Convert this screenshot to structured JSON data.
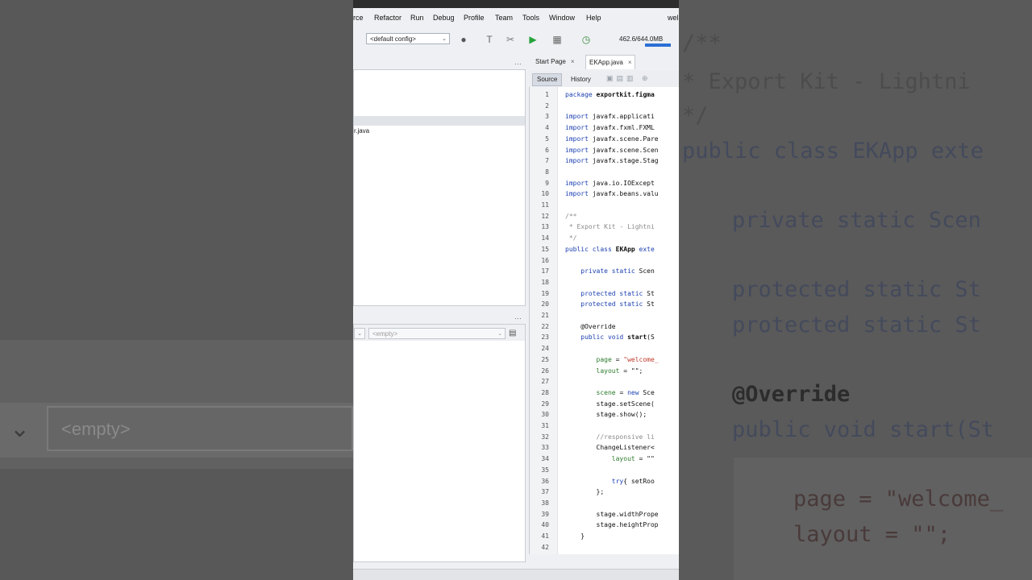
{
  "menu": [
    "rce",
    "Refactor",
    "Run",
    "Debug",
    "Profile",
    "Team",
    "Tools",
    "Window",
    "Help"
  ],
  "menu_right": "wel",
  "toolbar": {
    "config": "<default config>",
    "memory": "462.6/644.0MB"
  },
  "left_panel": {
    "file": "r.java"
  },
  "navigator": {
    "selector": "<empty>"
  },
  "tabs": [
    {
      "label": "Start Page"
    },
    {
      "label": "EKApp.java"
    }
  ],
  "editor_views": {
    "source": "Source",
    "history": "History"
  },
  "code_lines": [
    {
      "n": "1",
      "segs": [
        [
          "k",
          "package "
        ],
        [
          "bd",
          "exportkit.figma"
        ]
      ]
    },
    {
      "n": "2",
      "segs": []
    },
    {
      "n": "3",
      "segs": [
        [
          "k",
          "import "
        ],
        [
          "",
          "javafx.applicati"
        ]
      ]
    },
    {
      "n": "4",
      "segs": [
        [
          "k",
          "import "
        ],
        [
          "",
          "javafx.fxml.FXML"
        ]
      ]
    },
    {
      "n": "5",
      "segs": [
        [
          "k",
          "import "
        ],
        [
          "",
          "javafx.scene.Pare"
        ]
      ]
    },
    {
      "n": "6",
      "segs": [
        [
          "k",
          "import "
        ],
        [
          "",
          "javafx.scene.Scen"
        ]
      ]
    },
    {
      "n": "7",
      "segs": [
        [
          "k",
          "import "
        ],
        [
          "",
          "javafx.stage.Stag"
        ]
      ]
    },
    {
      "n": "8",
      "segs": []
    },
    {
      "n": "9",
      "segs": [
        [
          "k",
          "import "
        ],
        [
          "",
          "java.io.IOExcept"
        ]
      ]
    },
    {
      "n": "10",
      "segs": [
        [
          "k",
          "import "
        ],
        [
          "",
          "javafx.beans.valu"
        ]
      ]
    },
    {
      "n": "11",
      "segs": []
    },
    {
      "n": "12",
      "segs": [
        [
          "cm",
          "/**"
        ]
      ]
    },
    {
      "n": "13",
      "segs": [
        [
          "cm",
          " * Export Kit - Lightni"
        ]
      ]
    },
    {
      "n": "14",
      "segs": [
        [
          "cm",
          " */"
        ]
      ]
    },
    {
      "n": "15",
      "segs": [
        [
          "k",
          "public class "
        ],
        [
          "bd",
          "EKApp "
        ],
        [
          "k",
          "exte"
        ]
      ]
    },
    {
      "n": "16",
      "segs": []
    },
    {
      "n": "17",
      "segs": [
        [
          "k",
          "    private static "
        ],
        [
          "",
          "Scen"
        ]
      ]
    },
    {
      "n": "18",
      "segs": []
    },
    {
      "n": "19",
      "segs": [
        [
          "k",
          "    protected static "
        ],
        [
          "",
          "St"
        ]
      ]
    },
    {
      "n": "20",
      "segs": [
        [
          "k",
          "    protected static "
        ],
        [
          "",
          "St"
        ]
      ]
    },
    {
      "n": "21",
      "segs": []
    },
    {
      "n": "22",
      "segs": [
        [
          "",
          "    @Override"
        ]
      ]
    },
    {
      "n": "23",
      "segs": [
        [
          "k",
          "    public void "
        ],
        [
          "bd",
          "start"
        ],
        [
          "",
          "(S"
        ]
      ]
    },
    {
      "n": "24",
      "segs": []
    },
    {
      "n": "25",
      "segs": [
        [
          "vb",
          "        page "
        ],
        [
          "",
          "= "
        ],
        [
          "s",
          "\"welcome_"
        ]
      ]
    },
    {
      "n": "26",
      "segs": [
        [
          "vb",
          "        layout "
        ],
        [
          "",
          "= \"\";"
        ]
      ]
    },
    {
      "n": "27",
      "segs": []
    },
    {
      "n": "28",
      "segs": [
        [
          "vb",
          "        scene "
        ],
        [
          "",
          "= "
        ],
        [
          "k",
          "new "
        ],
        [
          "",
          "Sce"
        ]
      ]
    },
    {
      "n": "29",
      "segs": [
        [
          "",
          "        stage.setScene("
        ]
      ]
    },
    {
      "n": "30",
      "segs": [
        [
          "",
          "        stage.show();"
        ]
      ]
    },
    {
      "n": "31",
      "segs": []
    },
    {
      "n": "32",
      "segs": [
        [
          "cm",
          "        //responsive li"
        ]
      ]
    },
    {
      "n": "33",
      "segs": [
        [
          "",
          "        ChangeListener<"
        ]
      ]
    },
    {
      "n": "34",
      "segs": [
        [
          "vb",
          "            layout "
        ],
        [
          "",
          "= \"\""
        ]
      ]
    },
    {
      "n": "35",
      "segs": []
    },
    {
      "n": "36",
      "segs": [
        [
          "k",
          "            try"
        ],
        [
          "",
          "{ setRoo"
        ]
      ]
    },
    {
      "n": "37",
      "segs": [
        [
          "",
          "        };"
        ]
      ]
    },
    {
      "n": "38",
      "segs": []
    },
    {
      "n": "39",
      "segs": [
        [
          "",
          "        stage.widthPrope"
        ]
      ]
    },
    {
      "n": "40",
      "segs": [
        [
          "",
          "        stage.heightProp"
        ]
      ]
    },
    {
      "n": "41",
      "segs": [
        [
          "",
          "    }"
        ]
      ]
    },
    {
      "n": "42",
      "segs": []
    }
  ],
  "background_zoom": {
    "left_selector": "<empty>",
    "right_lines": [
      "/**",
      " * Export Kit - Lightni",
      " */",
      "public class EKApp exte",
      "private static Scen",
      "protected static St",
      "protected static St",
      "@Override",
      "public void start(St",
      "page = \"welcome_",
      "layout = \"\";"
    ]
  }
}
